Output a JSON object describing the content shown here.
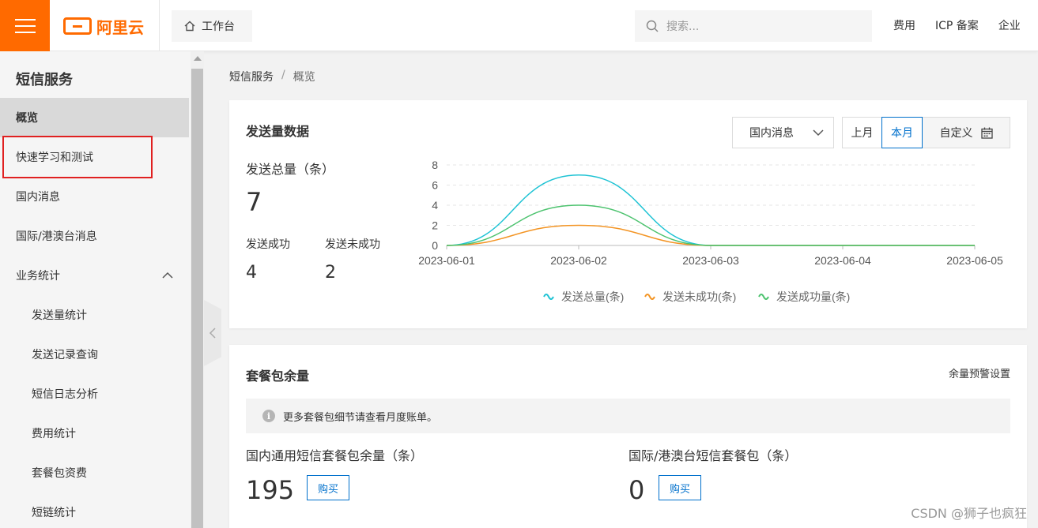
{
  "header": {
    "brand": "阿里云",
    "workbench_label": "工作台",
    "search_placeholder": "搜索...",
    "links": [
      "费用",
      "ICP 备案",
      "企业"
    ]
  },
  "sidebar": {
    "title": "短信服务",
    "items": [
      {
        "label": "概览",
        "active": true,
        "indent": false
      },
      {
        "label": "快速学习和测试",
        "active": false,
        "indent": false
      },
      {
        "label": "国内消息",
        "active": false,
        "indent": false
      },
      {
        "label": "国际/港澳台消息",
        "active": false,
        "indent": false
      },
      {
        "label": "业务统计",
        "active": false,
        "indent": false,
        "expanded": true
      },
      {
        "label": "发送量统计",
        "active": false,
        "indent": true
      },
      {
        "label": "发送记录查询",
        "active": false,
        "indent": true
      },
      {
        "label": "短信日志分析",
        "active": false,
        "indent": true
      },
      {
        "label": "费用统计",
        "active": false,
        "indent": true
      },
      {
        "label": "套餐包资费",
        "active": false,
        "indent": true
      },
      {
        "label": "短链统计",
        "active": false,
        "indent": true
      }
    ]
  },
  "breadcrumb": {
    "root": "短信服务",
    "separator": "/",
    "current": "概览"
  },
  "send_card": {
    "title": "发送量数据",
    "select_value": "国内消息",
    "range_buttons": [
      "上月",
      "本月"
    ],
    "active_range": "本月",
    "custom_label": "自定义",
    "total_label": "发送总量（条）",
    "total_value": "7",
    "success_label": "发送成功",
    "success_value": "4",
    "fail_label": "发送未成功",
    "fail_value": "2"
  },
  "chart_data": {
    "type": "line",
    "x": [
      "2023-06-01",
      "2023-06-02",
      "2023-06-03",
      "2023-06-04",
      "2023-06-05"
    ],
    "ylim": [
      0,
      8
    ],
    "yticks": [
      0,
      2,
      4,
      6,
      8
    ],
    "grid": true,
    "legend_position": "bottom",
    "series": [
      {
        "name": "发送总量(条)",
        "color": "#1fc3d4",
        "values": [
          0,
          7,
          0,
          0,
          0
        ]
      },
      {
        "name": "发送未成功(条)",
        "color": "#f39423",
        "values": [
          0,
          2,
          0,
          0,
          0
        ]
      },
      {
        "name": "发送成功量(条)",
        "color": "#4dc36f",
        "values": [
          0,
          4,
          0,
          0,
          0
        ]
      }
    ]
  },
  "package_card": {
    "title": "套餐包余量",
    "alert_link": "余量预警设置",
    "notice": "更多套餐包细节请查看月度账单。",
    "domestic_label": "国内通用短信套餐包余量（条）",
    "domestic_value": "195",
    "intl_label": "国际/港澳台短信套餐包（条）",
    "intl_value": "0",
    "buy_label": "购买"
  },
  "watermark": "CSDN @狮子也疯狂",
  "colors": {
    "brand": "#ff6a00",
    "link_blue": "#0070cc",
    "highlight_red": "#e02020"
  }
}
